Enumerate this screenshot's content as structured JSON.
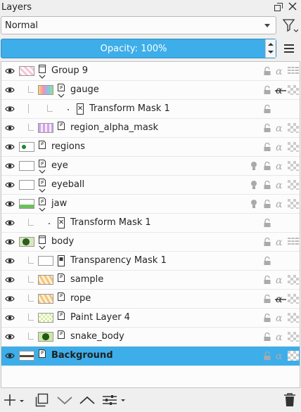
{
  "panel": {
    "title": "Layers"
  },
  "blend_mode": {
    "value": "Normal"
  },
  "opacity": {
    "label": "Opacity:  100%",
    "value": 100
  },
  "layers": [
    {
      "name": "Group 9",
      "kind": "group",
      "selected": false
    },
    {
      "name": "gauge",
      "kind": "paint",
      "selected": false
    },
    {
      "name": "Transform Mask 1",
      "kind": "transform-mask",
      "selected": false
    },
    {
      "name": "region_alpha_mask",
      "kind": "paint",
      "selected": false
    },
    {
      "name": "regions",
      "kind": "paint",
      "selected": false
    },
    {
      "name": "eye",
      "kind": "paint",
      "selected": false
    },
    {
      "name": "eyeball",
      "kind": "paint",
      "selected": false
    },
    {
      "name": "jaw",
      "kind": "paint",
      "selected": false
    },
    {
      "name": "Transform Mask 1",
      "kind": "transform-mask",
      "selected": false
    },
    {
      "name": "body",
      "kind": "group",
      "selected": false
    },
    {
      "name": "Transparency Mask 1",
      "kind": "transparency-mask",
      "selected": false
    },
    {
      "name": "sample",
      "kind": "paint",
      "selected": false
    },
    {
      "name": "rope",
      "kind": "paint",
      "selected": false
    },
    {
      "name": "Paint Layer 4",
      "kind": "paint",
      "selected": false
    },
    {
      "name": "snake_body",
      "kind": "paint",
      "selected": false
    },
    {
      "name": "Background",
      "kind": "paint",
      "selected": true
    }
  ],
  "colors": {
    "accent": "#3daee9",
    "background": "#efefef"
  }
}
